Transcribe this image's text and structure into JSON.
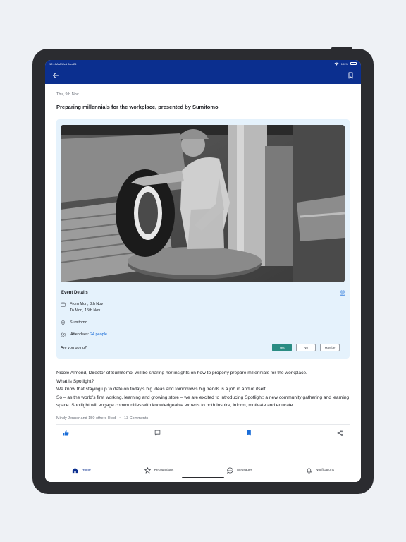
{
  "status_bar": {
    "time": "12:10AM Wed Jun 26",
    "battery": "100%"
  },
  "post": {
    "date": "Thu, 9th Nov",
    "title": "Preparing millennials for the workplace, presented by Sumitomo"
  },
  "event": {
    "section_title": "Event Details",
    "date_from": "From Mon, 8th Nov",
    "date_to": "To Mon, 15th Nov",
    "location": "Sumitomo",
    "attendees_label": "Attendees:",
    "attendees_link": "24 people",
    "question": "Are you going?",
    "options": [
      "Yes",
      "No",
      "May be"
    ],
    "selected_option": "Yes"
  },
  "body": [
    "Nicole Almond, Director of Sumitomo, will be sharing her insights on how to properly prepare millennials for the workplace.",
    "What is Spotlight?",
    "We know that staying up to date on today’s big ideas and tomorrow’s big trends is a job in and of itself.",
    "So – as the world’s first working, learning and growing store – we are excited to introducing Spotlight: a new community gathering and learning space. Spotlight will engage communities with knowledgeable experts to both inspire, inform, motivate and educate."
  ],
  "engagement": {
    "likes": "Mindy Jenner and 150 others liked",
    "separator": "•",
    "comments": "13 Comments"
  },
  "actions": {
    "like_icon": "thumbs-up-icon",
    "comment_icon": "comment-icon",
    "bookmark_icon": "bookmark-icon",
    "share_icon": "share-icon"
  },
  "tabs": [
    {
      "label": "Home",
      "icon": "home-icon",
      "active": true
    },
    {
      "label": "Recognitions",
      "icon": "star-icon",
      "active": false
    },
    {
      "label": "Messages",
      "icon": "message-icon",
      "active": false
    },
    {
      "label": "Notifications",
      "icon": "bell-icon",
      "active": false
    }
  ],
  "colors": {
    "brand": "#0b2f8f",
    "accent_teal": "#2a8c83",
    "link": "#1a6dd8",
    "card_bg": "#e5f2fc"
  }
}
